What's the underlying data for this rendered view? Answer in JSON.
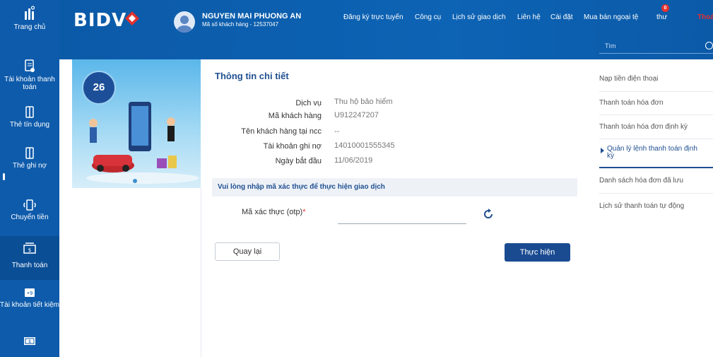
{
  "sidebar": {
    "items": [
      {
        "label": "Trang chủ",
        "icon": "home-icon"
      },
      {
        "label": "Tài khoản thanh toán",
        "icon": "account-icon"
      },
      {
        "label": "Thẻ tín dụng",
        "icon": "credit-card-icon"
      },
      {
        "label": "Thẻ ghi nợ",
        "icon": "debit-card-icon"
      },
      {
        "label": "Chuyển tiền",
        "icon": "transfer-icon"
      },
      {
        "label": "Thanh toán",
        "icon": "payment-icon"
      },
      {
        "label": "Tài khoản tiết kiệm",
        "icon": "savings-icon"
      },
      {
        "label": "",
        "icon": "money-icon"
      }
    ]
  },
  "header": {
    "logo_text": "BIDV",
    "user_name": "NGUYEN MAI PHUONG AN",
    "user_code": "Mã số khách hàng - 12537047",
    "nav": [
      "Đăng ký trực tuyến",
      "Công cụ",
      "Lịch sử giao dịch",
      "Liên hệ",
      "Cài đặt",
      "Mua bán ngoại tệ"
    ],
    "inbox_label": "thư",
    "inbox_count": "0",
    "logout_label": "Thoá",
    "search_placeholder": "Tìm"
  },
  "banner": {
    "badge_text": "26"
  },
  "main": {
    "title": "Thông tin chi tiết",
    "details": [
      {
        "label": "Dịch vụ",
        "value": "Thu hộ bảo hiểm"
      },
      {
        "label": "Mã khách hàng",
        "value": "U912247207"
      },
      {
        "label": "Tên khách hàng tại ncc",
        "value": "--"
      },
      {
        "label": "Tài khoản ghi nợ",
        "value": "14010001555345"
      },
      {
        "label": "Ngày bắt đầu",
        "value": "11/06/2019"
      }
    ],
    "otp_notice": "Vui lòng nhập mã xác thực để thực hiện giao dịch",
    "otp_label": "Mã xác thực (otp)",
    "otp_required": "*",
    "otp_value": "",
    "back_label": "Quay lại",
    "submit_label": "Thực hiện"
  },
  "right_menu": {
    "items": [
      {
        "label": "Nạp tiền điện thoại"
      },
      {
        "label": "Thanh toán hóa đơn"
      },
      {
        "label": "Thanh toán hóa đơn định kỳ"
      },
      {
        "label": "Quản lý lệnh thanh toán định kỳ"
      },
      {
        "label": "Danh sách hóa đơn đã lưu"
      },
      {
        "label": "Lịch sử thanh toán tự động"
      }
    ],
    "active_index": 3
  },
  "colors": {
    "brand_blue": "#0e5bab",
    "accent_red": "#e3312d",
    "button_navy": "#1a4b91"
  }
}
